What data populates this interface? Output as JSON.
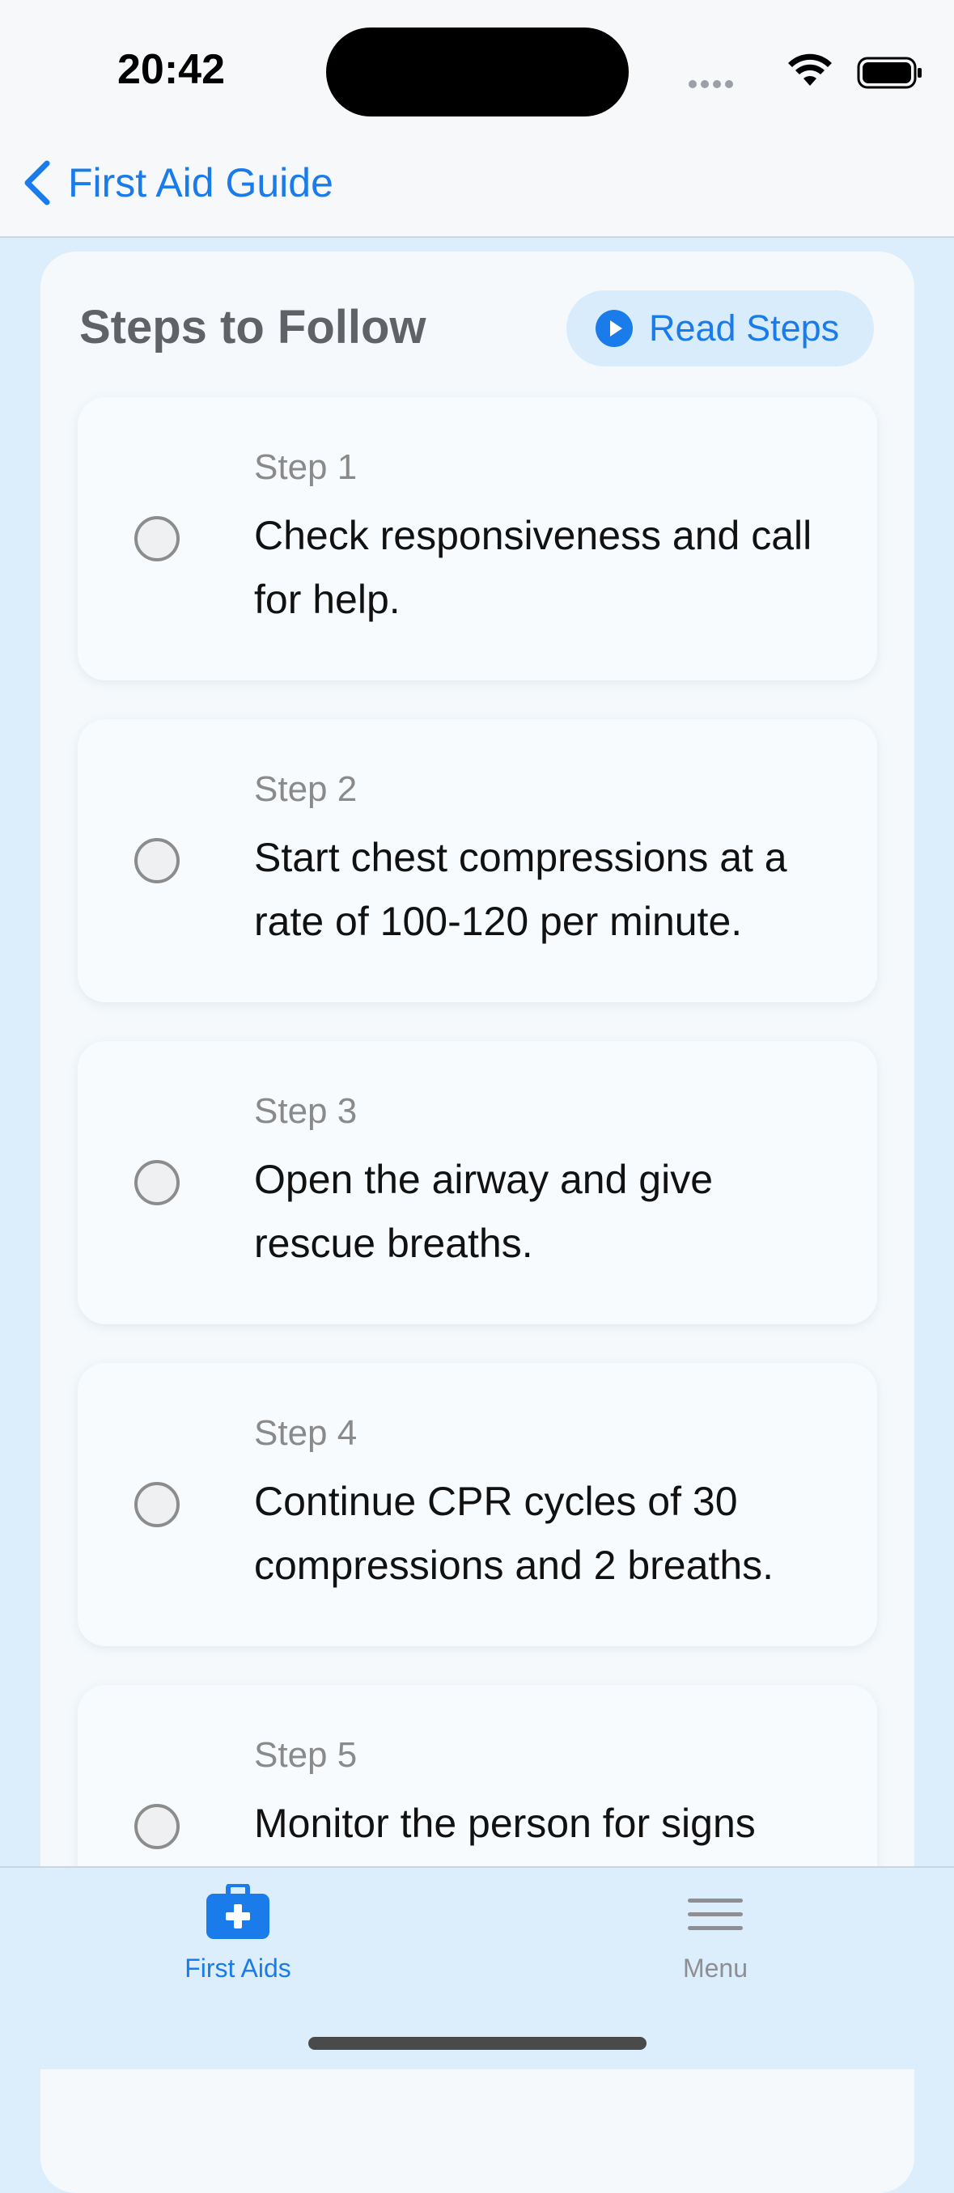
{
  "status_bar": {
    "time": "20:42"
  },
  "nav": {
    "back_label": "First Aid Guide"
  },
  "card": {
    "title": "Steps to Follow",
    "read_button": "Read Steps"
  },
  "steps": [
    {
      "label": "Step 1",
      "text": "Check responsiveness and call for help."
    },
    {
      "label": "Step 2",
      "text": "Start chest compressions at a rate of 100-120 per minute."
    },
    {
      "label": "Step 3",
      "text": "Open the airway and give rescue breaths."
    },
    {
      "label": "Step 4",
      "text": "Continue CPR cycles of 30 compressions and 2 breaths."
    },
    {
      "label": "Step 5",
      "text": "Monitor the person for signs"
    }
  ],
  "tabbar": {
    "first_aids": "First Aids",
    "menu": "Menu"
  },
  "colors": {
    "accent": "#1a7bea",
    "background": "#dceefb",
    "card": "#f5f9fc"
  }
}
